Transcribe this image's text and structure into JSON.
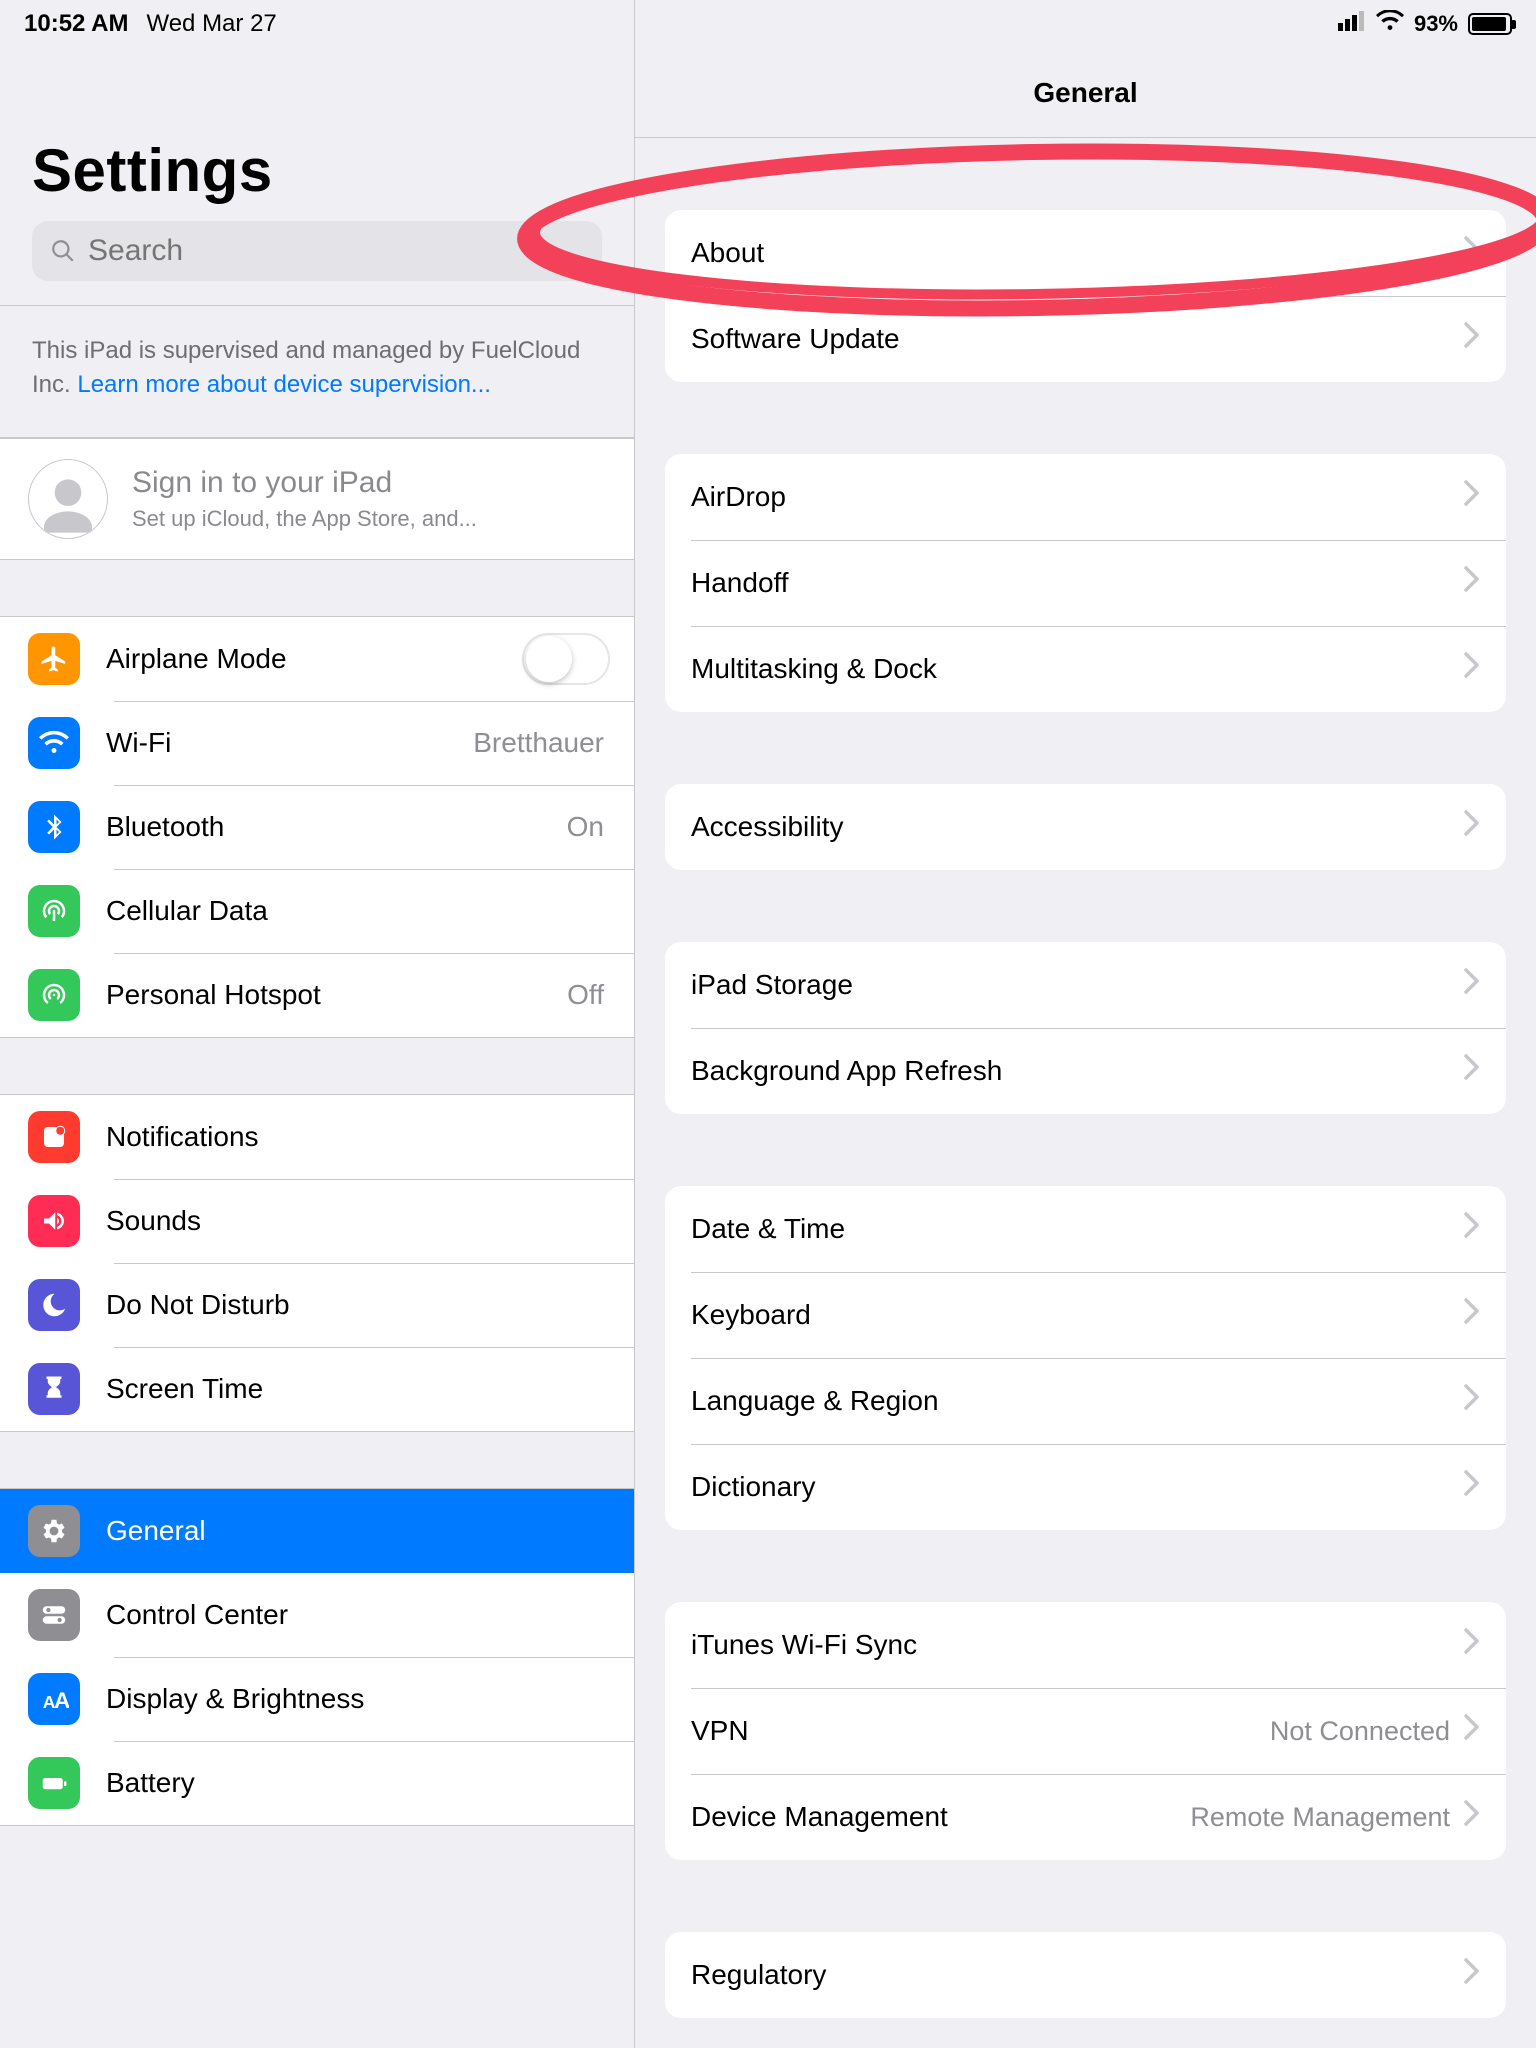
{
  "statusbar": {
    "time": "10:52 AM",
    "date": "Wed Mar 27",
    "battery_pct": "93%"
  },
  "sidebar": {
    "title": "Settings",
    "search_placeholder": "Search",
    "supervised_text": "This iPad is supervised and managed by FuelCloud Inc. ",
    "supervised_link": "Learn more about device supervision...",
    "signin_title": "Sign in to your iPad",
    "signin_sub": "Set up iCloud, the App Store, and...",
    "groups": [
      {
        "rows": [
          {
            "key": "airplane",
            "label": "Airplane Mode",
            "icon": "airplane",
            "color": "#ff9500",
            "toggle": true,
            "interact": true
          },
          {
            "key": "wifi",
            "label": "Wi-Fi",
            "icon": "wifi",
            "color": "#007aff",
            "value": "Bretthauer",
            "interact": true
          },
          {
            "key": "bluetooth",
            "label": "Bluetooth",
            "icon": "bluetooth",
            "color": "#007aff",
            "value": "On",
            "interact": true
          },
          {
            "key": "cellular",
            "label": "Cellular Data",
            "icon": "cellular",
            "color": "#34c759",
            "interact": true
          },
          {
            "key": "hotspot",
            "label": "Personal Hotspot",
            "icon": "hotspot",
            "color": "#34c759",
            "value": "Off",
            "interact": true
          }
        ]
      },
      {
        "rows": [
          {
            "key": "notifications",
            "label": "Notifications",
            "icon": "notifications",
            "color": "#ff3b30",
            "interact": true
          },
          {
            "key": "sounds",
            "label": "Sounds",
            "icon": "sounds",
            "color": "#ff2d55",
            "interact": true
          },
          {
            "key": "dnd",
            "label": "Do Not Disturb",
            "icon": "moon",
            "color": "#5856d6",
            "interact": true
          },
          {
            "key": "screentime",
            "label": "Screen Time",
            "icon": "hourglass",
            "color": "#5856d6",
            "interact": true
          }
        ]
      },
      {
        "rows": [
          {
            "key": "general",
            "label": "General",
            "icon": "gear",
            "color": "#8e8e93",
            "selected": true,
            "interact": true
          },
          {
            "key": "controlcenter",
            "label": "Control Center",
            "icon": "switches",
            "color": "#8e8e93",
            "interact": true
          },
          {
            "key": "display",
            "label": "Display & Brightness",
            "icon": "textsize",
            "color": "#007aff",
            "interact": true
          },
          {
            "key": "battery",
            "label": "Battery",
            "icon": "battery",
            "color": "#34c759",
            "interact": true
          }
        ]
      }
    ]
  },
  "detail": {
    "title": "General",
    "groups": [
      {
        "rows": [
          {
            "label": "About",
            "annot": true
          },
          {
            "label": "Software Update"
          }
        ]
      },
      {
        "rows": [
          {
            "label": "AirDrop"
          },
          {
            "label": "Handoff"
          },
          {
            "label": "Multitasking & Dock"
          }
        ]
      },
      {
        "rows": [
          {
            "label": "Accessibility"
          }
        ]
      },
      {
        "rows": [
          {
            "label": "iPad Storage"
          },
          {
            "label": "Background App Refresh"
          }
        ]
      },
      {
        "rows": [
          {
            "label": "Date & Time"
          },
          {
            "label": "Keyboard"
          },
          {
            "label": "Language & Region"
          },
          {
            "label": "Dictionary"
          }
        ]
      },
      {
        "rows": [
          {
            "label": "iTunes Wi-Fi Sync"
          },
          {
            "label": "VPN",
            "value": "Not Connected"
          },
          {
            "label": "Device Management",
            "value": "Remote Management"
          }
        ]
      },
      {
        "rows": [
          {
            "label": "Regulatory"
          }
        ]
      }
    ]
  },
  "colors": {
    "annotation": "#f3415a"
  }
}
